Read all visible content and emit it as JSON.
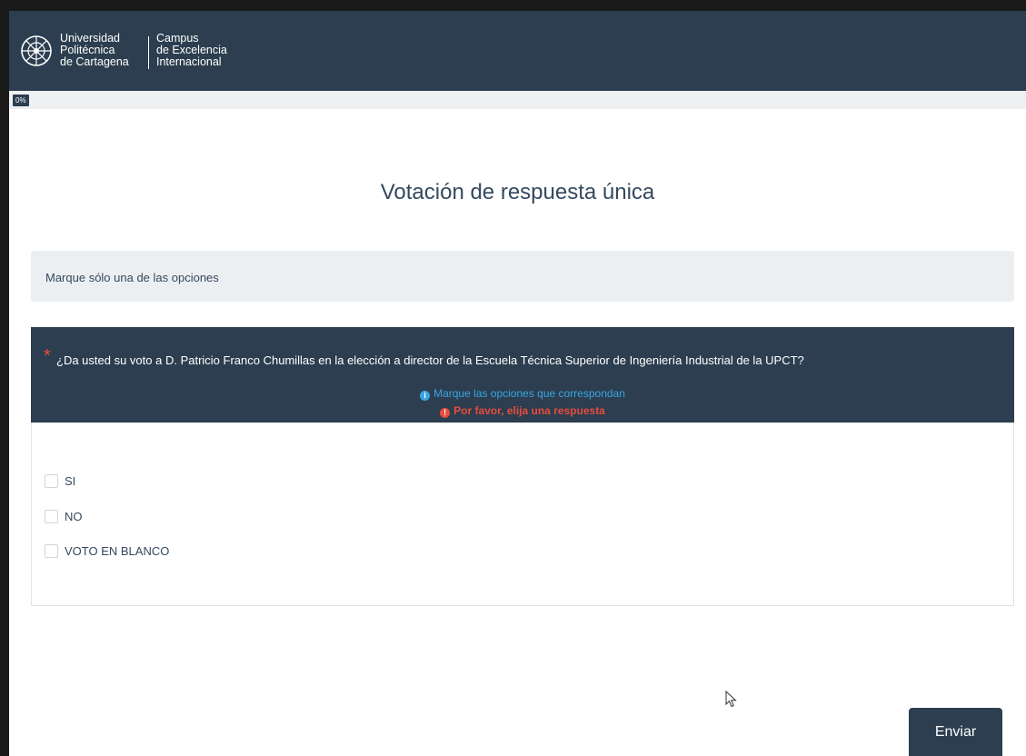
{
  "header": {
    "university_lines": [
      "Universidad",
      "Politécnica",
      "de Cartagena"
    ],
    "campus_lines": [
      "Campus",
      "de Excelencia",
      "Internacional"
    ]
  },
  "progress": {
    "label": "0%",
    "value": 0
  },
  "survey": {
    "title": "Votación de respuesta única",
    "instructions": "Marque sólo una de las opciones"
  },
  "question": {
    "required_mark": "*",
    "text": "¿Da usted su voto a D. Patricio Franco Chumillas en la elección a director de la Escuela Técnica Superior de Ingeniería Industrial de la UPCT?",
    "tip": "Marque las opciones que correspondan",
    "error": "Por favor, elija una respuesta",
    "options": [
      "SI",
      "NO",
      "VOTO EN BLANCO"
    ]
  },
  "actions": {
    "submit_label": "Enviar"
  },
  "colors": {
    "header_bg": "#2c3e50",
    "tip": "#3aa6e0",
    "error": "#e74c3c"
  },
  "icons": [
    "university-logo-icon",
    "info-icon",
    "error-icon",
    "mouse-cursor-icon"
  ]
}
